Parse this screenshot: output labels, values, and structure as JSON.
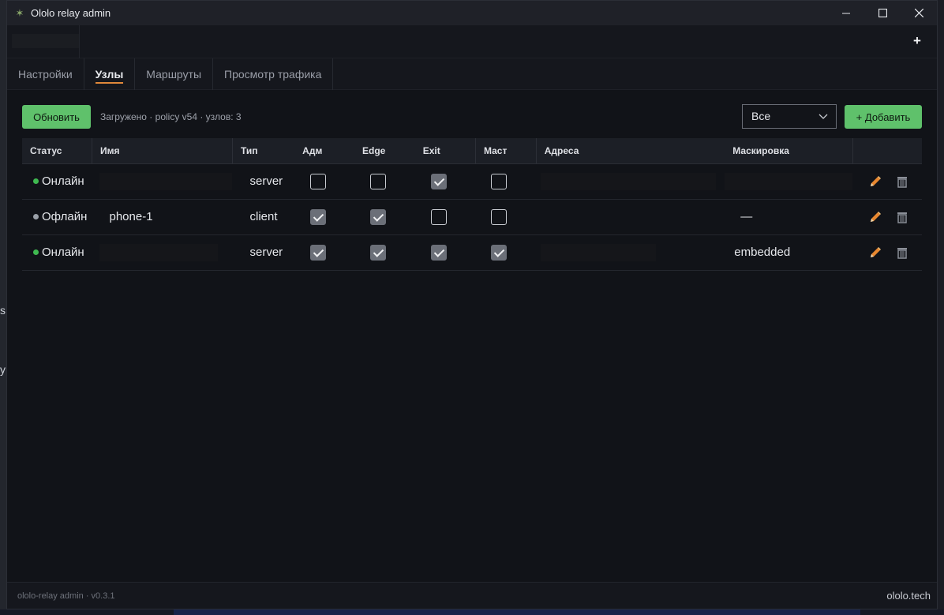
{
  "window": {
    "title": "Ololo relay admin",
    "minimize": "minimize",
    "maximize": "maximize",
    "close": "close"
  },
  "tabs": [
    {
      "label": "Настройки"
    },
    {
      "label": "Узлы"
    },
    {
      "label": "Маршруты"
    },
    {
      "label": "Просмотр трафика"
    }
  ],
  "actions": {
    "refresh_label": "Обновить",
    "status_text": "Загружено · policy v54 · узлов: 3",
    "filter_value": "Все",
    "add_label": "+ Добавить"
  },
  "table": {
    "headers": [
      "Статус",
      "Имя",
      "Тип",
      "Адм",
      "Edge",
      "Exit",
      "Маст",
      "Адреса",
      "Маскировка"
    ],
    "rows": [
      {
        "status": "Онлайн",
        "online": true,
        "name": "",
        "type": "server",
        "adm": false,
        "edge": false,
        "exit": true,
        "mast": false,
        "addresses": "",
        "mask": ""
      },
      {
        "status": "Офлайн",
        "online": false,
        "name": "phone-1",
        "type": "client",
        "adm": true,
        "edge": true,
        "exit": false,
        "mast": false,
        "addresses": "",
        "mask": "—"
      },
      {
        "status": "Онлайн",
        "online": true,
        "name": "",
        "type": "server",
        "adm": true,
        "edge": true,
        "exit": true,
        "mast": true,
        "addresses": "",
        "mask": "embedded"
      }
    ]
  },
  "footer": {
    "version": "ololo-relay admin · v0.3.1",
    "brand": "ololo.tech"
  },
  "colors": {
    "accent_green": "#5fc16b",
    "tab_underline": "#e0883a",
    "online": "#3fb950",
    "offline": "#9aa0a8"
  },
  "icons": {
    "edit": "pencil-icon",
    "delete": "trash-icon",
    "app": "star-icon"
  }
}
